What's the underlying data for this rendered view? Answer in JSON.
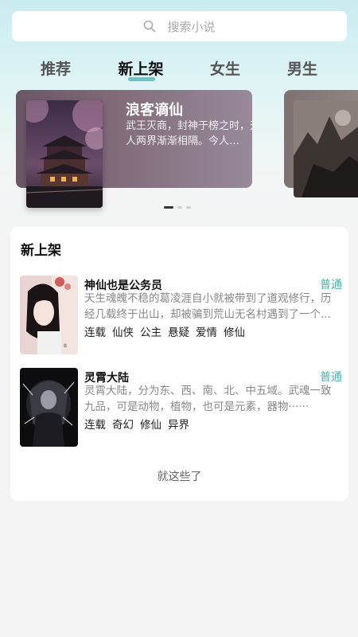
{
  "search": {
    "placeholder": "搜索小说"
  },
  "tabs": [
    {
      "label": "推荐"
    },
    {
      "label": "新上架"
    },
    {
      "label": "女生"
    },
    {
      "label": "男生"
    }
  ],
  "active_tab": "新上架",
  "carousel": {
    "items": [
      {
        "title": "浪客谪仙",
        "desc": "武王灭商，封神于榜之时，天人两界渐渐相隔。今人…"
      }
    ],
    "page_count": 3,
    "current_page": 1
  },
  "section": {
    "title": "新上架",
    "books": [
      {
        "title": "神仙也是公务员",
        "tag": "普通",
        "desc": "天生魂魄不稳的葛凌涯自小就被带到了道观修行，历经几载终于出山，却被骗到荒山无名村遇到了一个...",
        "genres": [
          "连载",
          "仙侠",
          "公主",
          "悬疑",
          "爱情",
          "修仙"
        ]
      },
      {
        "title": "灵霄大陆",
        "tag": "普通",
        "desc": "灵霄大陆，分为东、西、南、北、中五域。武魂一致九品，可是动物，植物，也可是元素，器物······",
        "genres": [
          "连载",
          "奇幻",
          "修仙",
          "异界"
        ]
      }
    ],
    "footer": "就这些了"
  },
  "colors": {
    "accent": "#6cc5c4",
    "tag": "#3fb6ae"
  }
}
